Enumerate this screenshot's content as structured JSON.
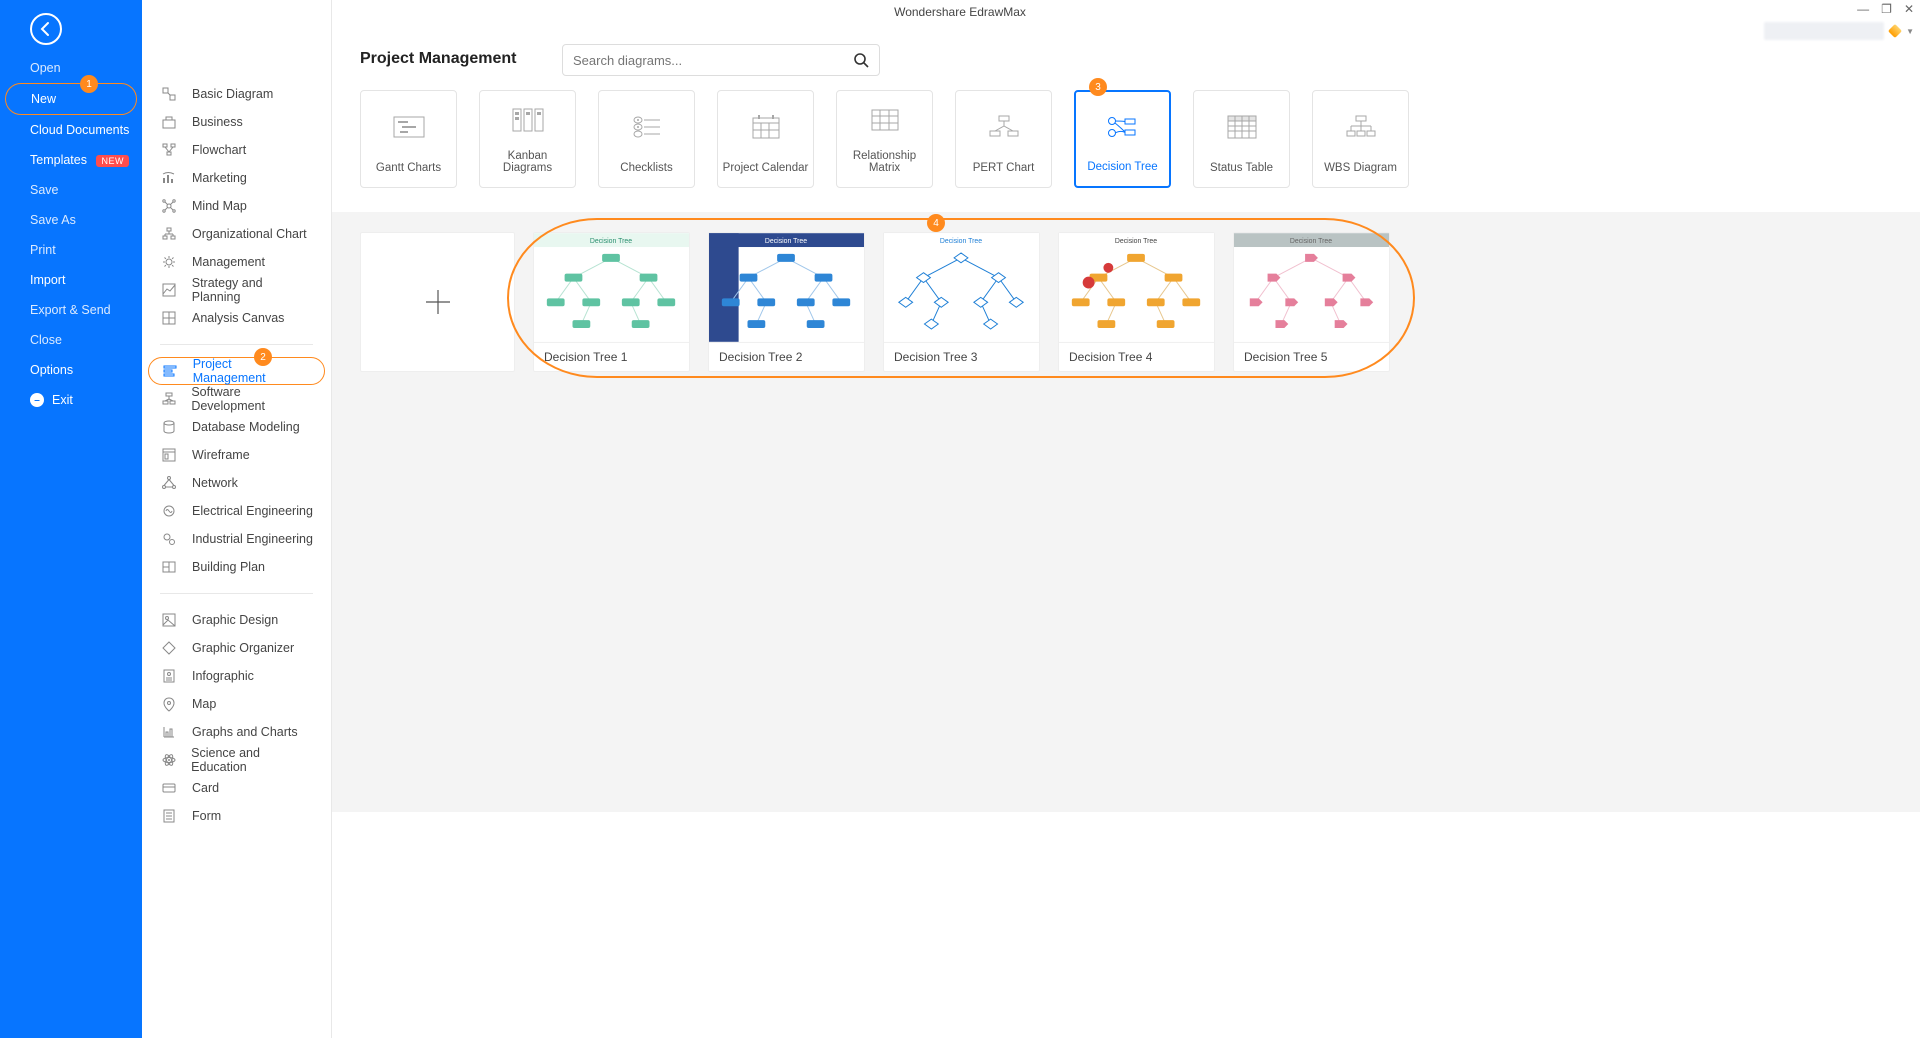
{
  "app_title": "Wondershare EdrawMax",
  "window": {
    "min": "—",
    "max": "❐",
    "close": "✕"
  },
  "left_nav": {
    "open": "Open",
    "new": "New",
    "cloud": "Cloud Documents",
    "templates": "Templates",
    "templates_badge": "NEW",
    "save": "Save",
    "save_as": "Save As",
    "print": "Print",
    "import": "Import",
    "export": "Export & Send",
    "close": "Close",
    "options": "Options",
    "exit": "Exit"
  },
  "callouts": {
    "c1": "1",
    "c2": "2",
    "c3": "3",
    "c4": "4"
  },
  "page_title": "Project Management",
  "search_placeholder": "Search diagrams...",
  "categories_group1": [
    "Basic Diagram",
    "Business",
    "Flowchart",
    "Marketing",
    "Mind Map",
    "Organizational Chart",
    "Management",
    "Strategy and Planning",
    "Analysis Canvas"
  ],
  "categories_group2": [
    "Project Management",
    "Software Development",
    "Database Modeling",
    "Wireframe",
    "Network",
    "Electrical Engineering",
    "Industrial Engineering",
    "Building Plan"
  ],
  "categories_group3": [
    "Graphic Design",
    "Graphic Organizer",
    "Infographic",
    "Map",
    "Graphs and Charts",
    "Science and Education",
    "Card",
    "Form"
  ],
  "selected_category": "Project Management",
  "types": [
    {
      "label": "Gantt Charts"
    },
    {
      "label": "Kanban Diagrams"
    },
    {
      "label": "Checklists"
    },
    {
      "label": "Project Calendar"
    },
    {
      "label": "Relationship Matrix"
    },
    {
      "label": "PERT Chart"
    },
    {
      "label": "Decision Tree",
      "selected": true
    },
    {
      "label": "Status Table"
    },
    {
      "label": "WBS Diagram"
    }
  ],
  "templates": [
    {
      "label": "Decision Tree 1"
    },
    {
      "label": "Decision Tree 2"
    },
    {
      "label": "Decision Tree 3"
    },
    {
      "label": "Decision Tree 4"
    },
    {
      "label": "Decision Tree 5"
    }
  ]
}
